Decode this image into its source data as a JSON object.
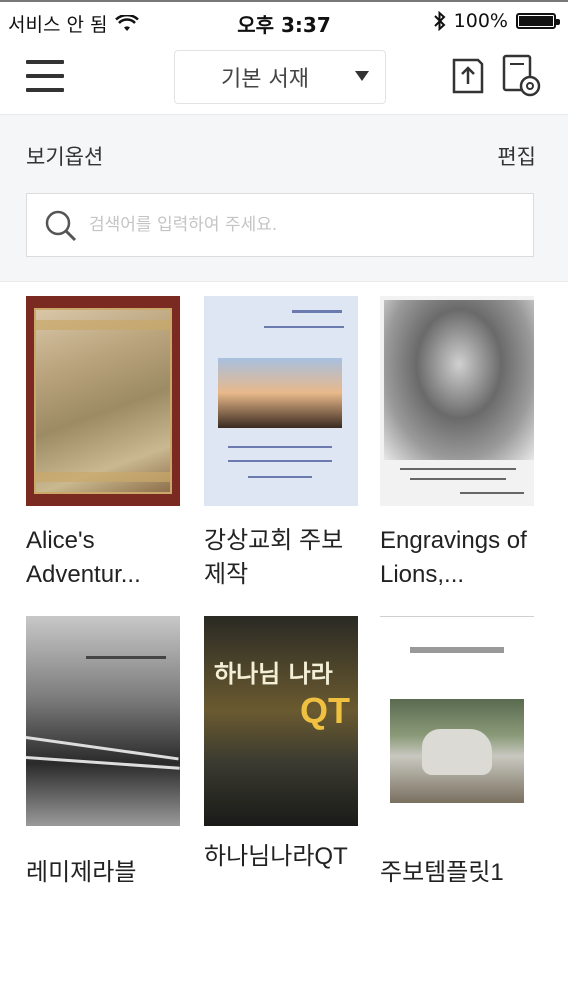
{
  "status_bar": {
    "carrier": "서비스 안 됨",
    "time": "오후 3:37",
    "battery": "100%"
  },
  "header": {
    "shelf_label": "기본 서재",
    "icons": [
      "menu-icon",
      "chevron-down-icon",
      "upload-icon",
      "settings-icon"
    ]
  },
  "options": {
    "view_options_label": "보기옵션",
    "edit_label": "편집",
    "search_placeholder": "검색어를 입력하여 주세요."
  },
  "books": [
    {
      "title": "Alice's Adventur..."
    },
    {
      "title": "강상교회 주보제작"
    },
    {
      "title": "Engravings of Lions,..."
    },
    {
      "title": "레미제라블"
    },
    {
      "title": "하나님나라QT"
    },
    {
      "title": "주보템플릿1"
    }
  ],
  "cover_texts": {
    "qt_big": "하나님 나라",
    "qt_small": "QT"
  },
  "colors": {
    "panel_bg": "#f4f6f8",
    "text": "#222222"
  }
}
